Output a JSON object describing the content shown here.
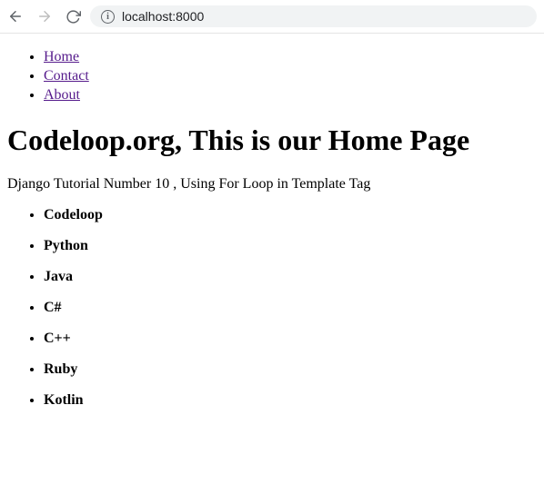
{
  "browser": {
    "url": "localhost:8000"
  },
  "nav": {
    "items": [
      {
        "label": "Home"
      },
      {
        "label": "Contact"
      },
      {
        "label": "About"
      }
    ]
  },
  "main": {
    "heading": "Codeloop.org, This is our Home Page",
    "subtitle": "Django Tutorial Number 10 , Using For Loop in Template Tag",
    "technologies": [
      "Codeloop",
      "Python",
      "Java",
      "C#",
      "C++",
      "Ruby",
      "Kotlin"
    ]
  }
}
